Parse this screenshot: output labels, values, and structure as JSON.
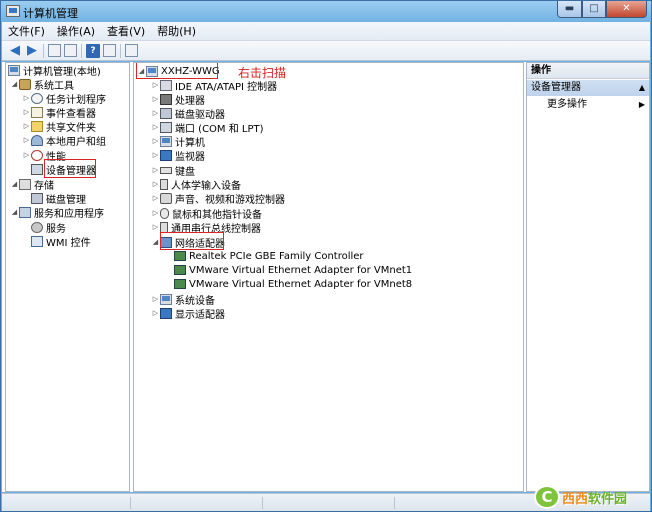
{
  "window": {
    "title": "计算机管理"
  },
  "caption": {
    "minimize": "▬",
    "maximize": "□",
    "close": "✕"
  },
  "menubar": [
    "文件(F)",
    "操作(A)",
    "查看(V)",
    "帮助(H)"
  ],
  "nav_tree": {
    "root": "计算机管理(本地)",
    "system_tools": "系统工具",
    "task_scheduler": "任务计划程序",
    "event_viewer": "事件查看器",
    "shared_folders": "共享文件夹",
    "local_users": "本地用户和组",
    "performance": "性能",
    "device_manager": "设备管理器",
    "storage": "存储",
    "disk_management": "磁盘管理",
    "services_apps": "服务和应用程序",
    "services": "服务",
    "wmi": "WMI 控件"
  },
  "device_tree": {
    "computer": "XXHZ-WWG",
    "annotation": "右击扫描",
    "items": [
      "IDE ATA/ATAPI 控制器",
      "处理器",
      "磁盘驱动器",
      "端口 (COM 和 LPT)",
      "计算机",
      "监视器",
      "键盘",
      "人体学输入设备",
      "声音、视频和游戏控制器",
      "鼠标和其他指针设备",
      "通用串行总线控制器",
      "网络适配器"
    ],
    "network_adapters": [
      "Realtek PCIe GBE Family Controller",
      "VMware Virtual Ethernet Adapter for VMnet1",
      "VMware Virtual Ethernet Adapter for VMnet8"
    ],
    "after": [
      "系统设备",
      "显示适配器"
    ]
  },
  "actions": {
    "header": "操作",
    "section": "设备管理器",
    "more": "更多操作"
  },
  "watermark": {
    "logo": "C",
    "text_a": "西西",
    "text_b": "软件园"
  }
}
